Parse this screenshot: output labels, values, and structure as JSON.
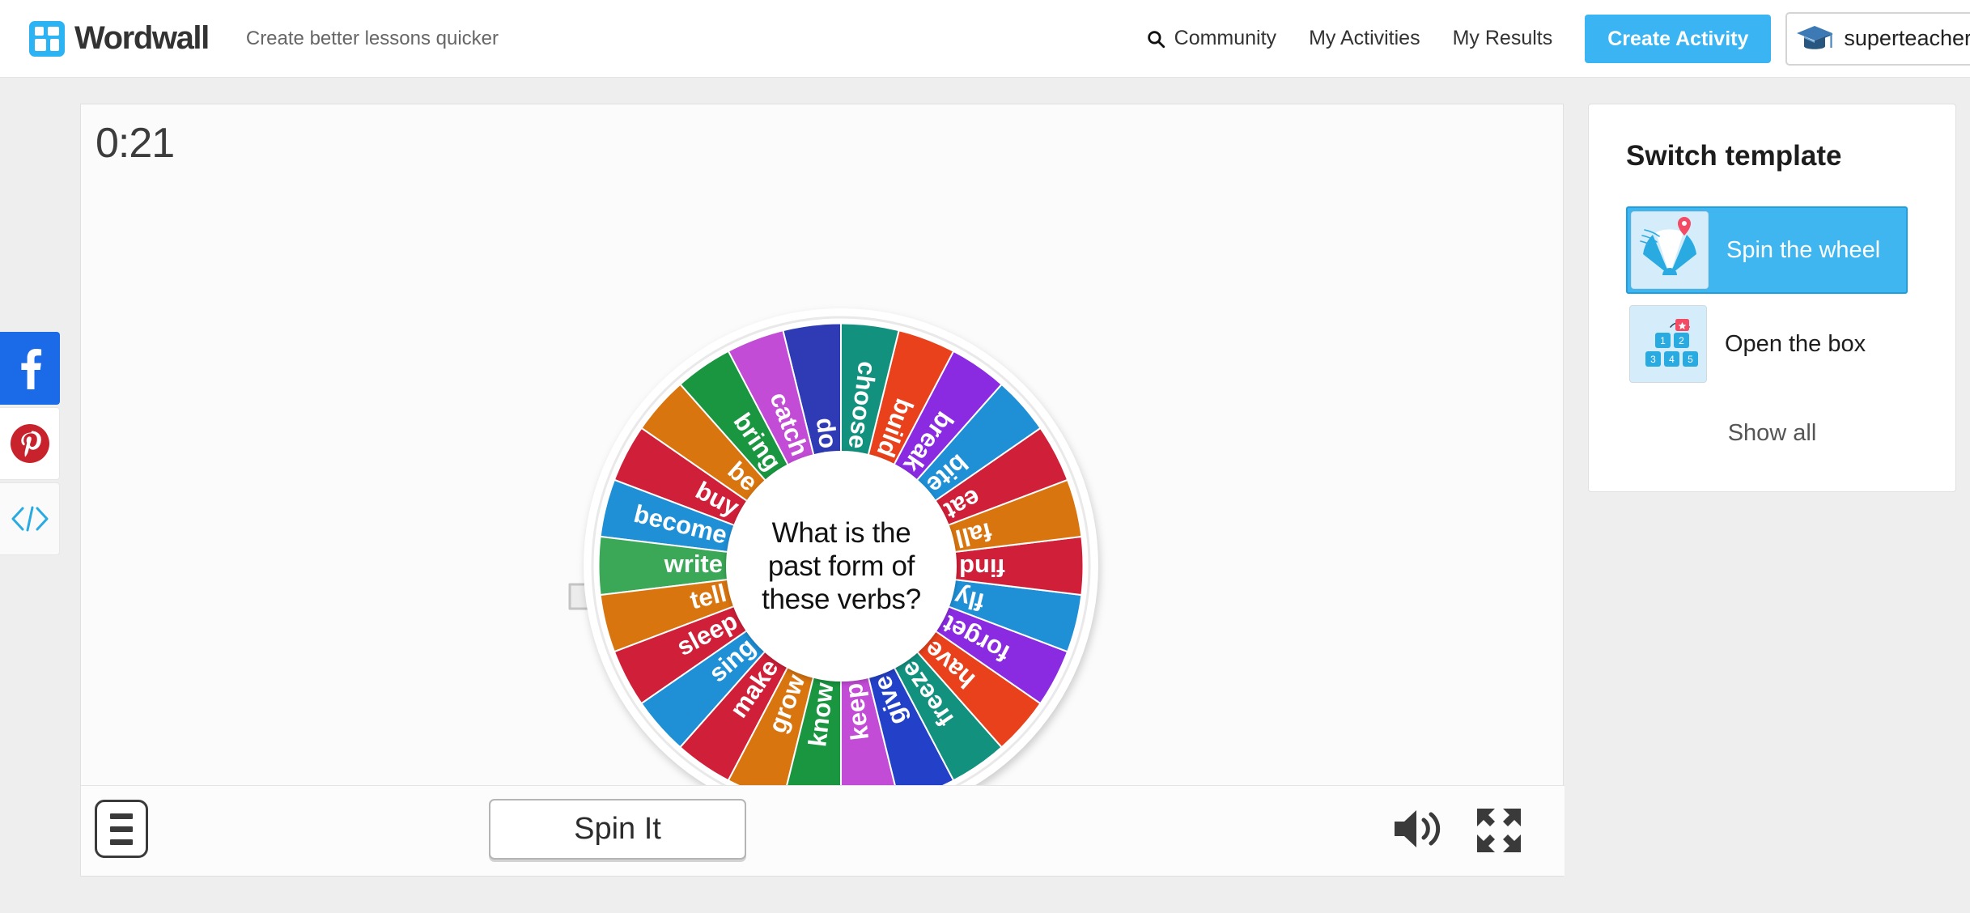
{
  "header": {
    "brand": "Wordwall",
    "tagline": "Create better lessons quicker",
    "nav": [
      {
        "label": "Community",
        "icon": "search-icon"
      },
      {
        "label": "My Activities",
        "icon": ""
      },
      {
        "label": "My Results",
        "icon": ""
      }
    ],
    "create_button": "Create Activity",
    "account_name": "superteacher.",
    "account_icon": "graduation-cap-icon",
    "accent_color": "#3ab4f2"
  },
  "social_rail": [
    {
      "name": "facebook-share-button",
      "glyph": "f",
      "bg": "#1b6ae8"
    },
    {
      "name": "pinterest-share-button",
      "glyph": "P",
      "bg": "#ffffff"
    },
    {
      "name": "embed-code-button",
      "glyph": "</>",
      "bg": "#fafafa"
    }
  ],
  "activity": {
    "timer": "0:21",
    "center_question": "What is the\npast form of\nthese verbs?",
    "spin_button": "Spin It",
    "menu_icon": "hamburger-menu-icon",
    "sound_icon": "speaker-on-icon",
    "fullscreen_icon": "fullscreen-expand-icon",
    "pointer_icon": "arrow-right-pointer"
  },
  "wheel": {
    "segment_count": 24,
    "palette": {
      "blue_dark": "#2e3bb5",
      "teal": "#13917f",
      "orange_red": "#e8411c",
      "purple": "#8a2be2",
      "blue": "#1f8fd6",
      "crimson": "#d01f38",
      "orange": "#d9750f",
      "magenta": "#c24cd6",
      "green": "#1a9641",
      "green_mid": "#3aa857",
      "blue_royal": "#2341c8"
    },
    "segments": [
      {
        "label": "do",
        "color": "#2e3bb5"
      },
      {
        "label": "catch",
        "color": "#c24cd6"
      },
      {
        "label": "bring",
        "color": "#1a9641"
      },
      {
        "label": "be",
        "color": "#d9750f"
      },
      {
        "label": "buy",
        "color": "#d01f38"
      },
      {
        "label": "become",
        "color": "#1f8fd6"
      },
      {
        "label": "write",
        "color": "#3aa857"
      },
      {
        "label": "tell",
        "color": "#d9750f"
      },
      {
        "label": "sleep",
        "color": "#d01f38"
      },
      {
        "label": "sing",
        "color": "#1f8fd6"
      },
      {
        "label": "make",
        "color": "#d01f38"
      },
      {
        "label": "grow",
        "color": "#d9750f"
      },
      {
        "label": "know",
        "color": "#1a9641"
      },
      {
        "label": "keep",
        "color": "#c24cd6"
      },
      {
        "label": "give",
        "color": "#2341c8"
      },
      {
        "label": "freeze",
        "color": "#13917f"
      },
      {
        "label": "have",
        "color": "#e8411c"
      },
      {
        "label": "forget",
        "color": "#8a2be2"
      },
      {
        "label": "fly",
        "color": "#1f8fd6"
      },
      {
        "label": "find",
        "color": "#d01f38"
      },
      {
        "label": "fall",
        "color": "#d9750f"
      },
      {
        "label": "eat",
        "color": "#d01f38"
      },
      {
        "label": "bite",
        "color": "#1f8fd6"
      },
      {
        "label": "break",
        "color": "#8a2be2"
      },
      {
        "label": "build",
        "color": "#e8411c"
      },
      {
        "label": "choose",
        "color": "#13917f"
      }
    ]
  },
  "switch_panel": {
    "title": "Switch template",
    "templates": [
      {
        "label": "Spin the wheel",
        "active": true,
        "icon": "spin-wheel-thumb"
      },
      {
        "label": "Open the box",
        "active": false,
        "icon": "open-box-thumb"
      }
    ],
    "show_all": "Show all"
  }
}
